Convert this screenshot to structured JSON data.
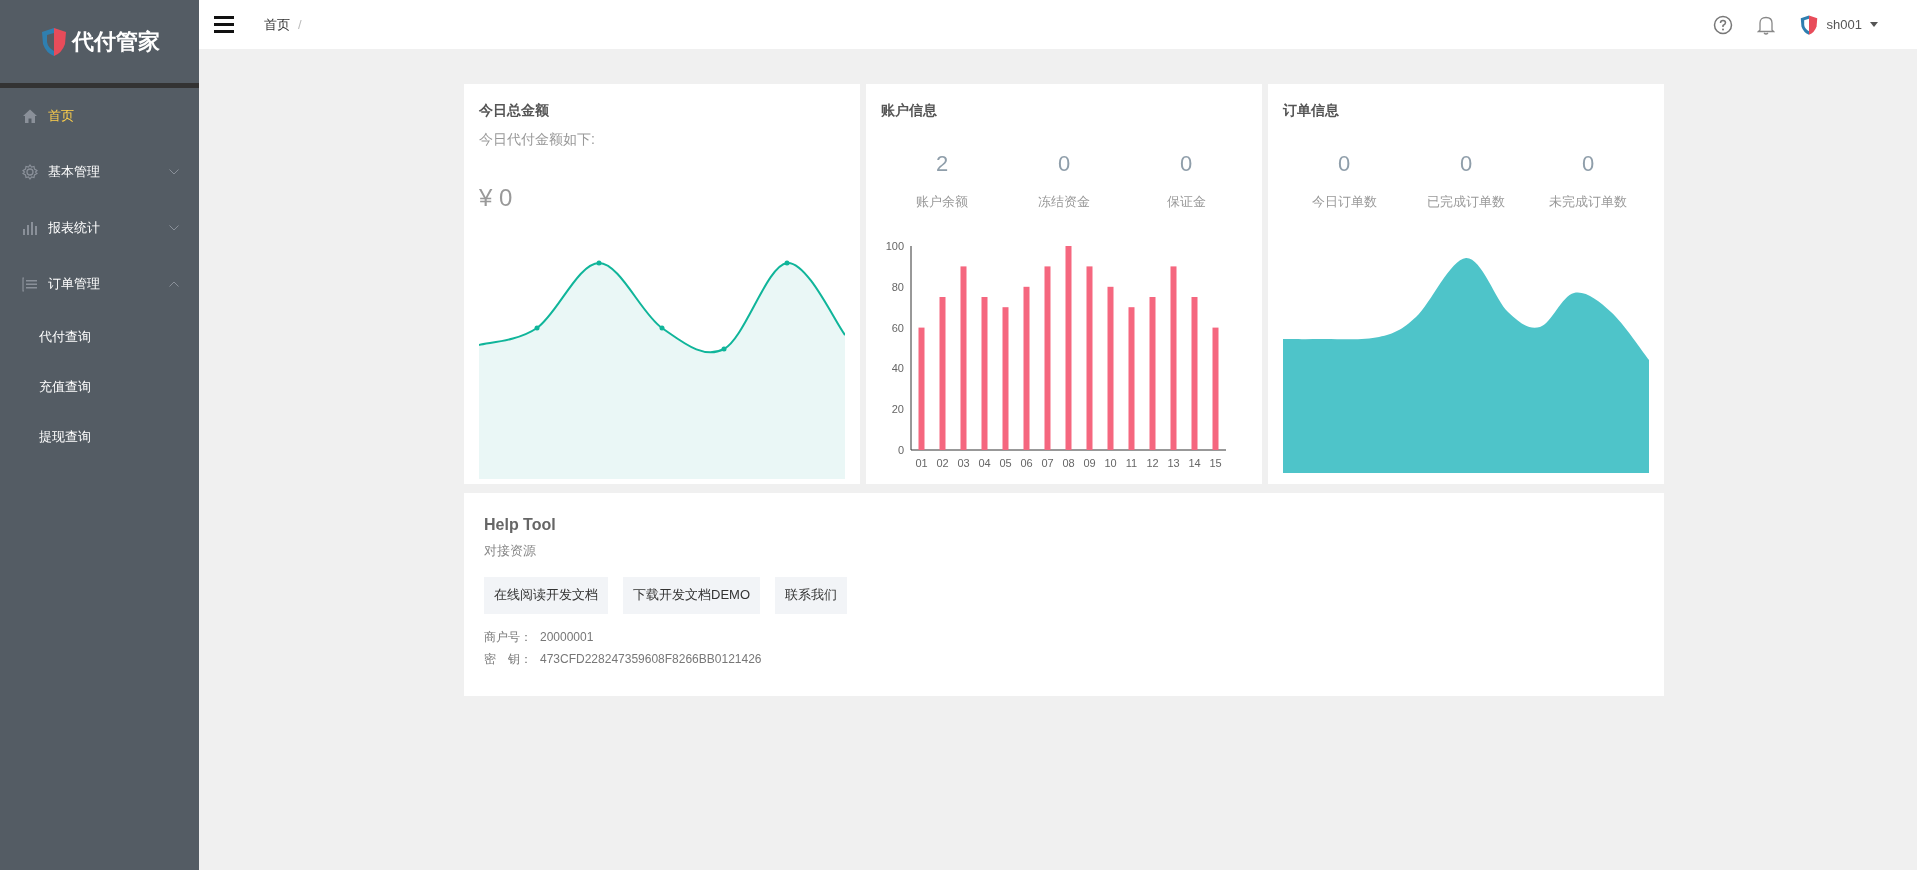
{
  "sidebar": {
    "logo": "代付管家",
    "menu": [
      {
        "label": "首页",
        "selected": true
      },
      {
        "label": "基本管理",
        "selected": false,
        "expanded": false
      },
      {
        "label": "报表统计",
        "selected": false,
        "expanded": false
      },
      {
        "label": "订单管理",
        "selected": false,
        "expanded": true,
        "children": [
          {
            "label": "代付查询",
            "selected": false
          },
          {
            "label": "充值查询",
            "selected": false
          },
          {
            "label": "提现查询",
            "selected": false
          }
        ]
      }
    ]
  },
  "header": {
    "breadcrumb": [
      {
        "label": "首页",
        "separator": "/"
      }
    ],
    "user": "sh001"
  },
  "today": {
    "title": "今日总金额",
    "subtitle": "今日代付金额如下:",
    "amount": "¥ 0"
  },
  "account": {
    "title": "账户信息",
    "stats": [
      {
        "value": "2",
        "label": "账户余额"
      },
      {
        "value": "0",
        "label": "冻结资金"
      },
      {
        "value": "0",
        "label": "保证金"
      }
    ],
    "chart_data": {
      "type": "bar",
      "categories": [
        "01",
        "02",
        "03",
        "04",
        "05",
        "06",
        "07",
        "08",
        "09",
        "10",
        "11",
        "12",
        "13",
        "14",
        "15"
      ],
      "values": [
        60,
        75,
        90,
        75,
        70,
        80,
        90,
        100,
        90,
        80,
        70,
        75,
        90,
        75,
        60
      ],
      "ylim": [
        0,
        100
      ],
      "yticks": [
        0,
        20,
        40,
        60,
        80,
        100
      ]
    }
  },
  "orders": {
    "title": "订单信息",
    "stats": [
      {
        "value": "0",
        "label": "今日订单数"
      },
      {
        "value": "0",
        "label": "已完成订单数"
      },
      {
        "value": "0",
        "label": "未完成订单数"
      }
    ]
  },
  "help": {
    "title": "Help Tool",
    "subtitle": "对接资源",
    "buttons": [
      "在线阅读开发文档",
      "下载开发文档DEMO",
      "联系我们"
    ],
    "info": [
      {
        "label": "商户号：",
        "value": "20000001"
      },
      {
        "label": "密　钥：",
        "value": "473CFD228247359608F8266BB0121426"
      }
    ]
  }
}
